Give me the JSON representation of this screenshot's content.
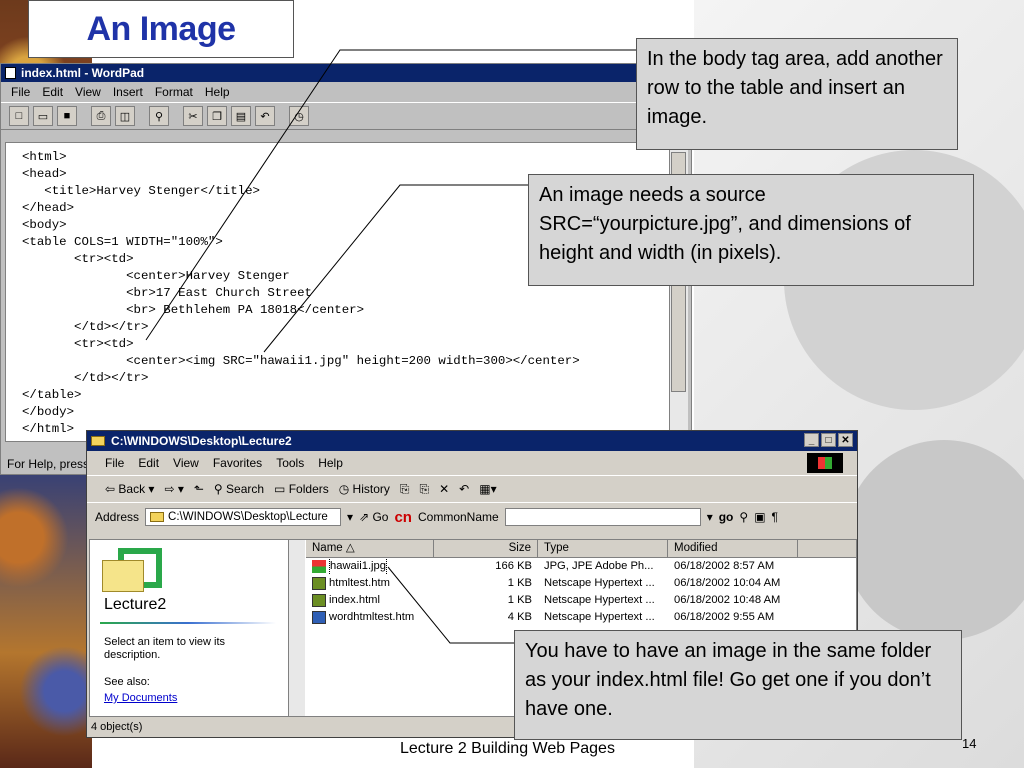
{
  "slide": {
    "title": "An Image",
    "footer": "Lecture 2 Building Web Pages",
    "page_number": "14"
  },
  "wordpad": {
    "window_title": "index.html - WordPad",
    "menu": [
      "File",
      "Edit",
      "View",
      "Insert",
      "Format",
      "Help"
    ],
    "code": "<html>\n<head>\n   <title>Harvey Stenger</title>\n</head>\n<body>\n<table COLS=1 WIDTH=\"100%\">\n       <tr><td>\n              <center>Harvey Stenger\n              <br>17 East Church Street\n              <br> Bethlehem PA 18018</center>\n       </td></tr>\n       <tr><td>\n              <center><img SRC=\"hawaii1.jpg\" height=200 width=300></center>\n       </td></tr>\n</table>\n</body>\n</html>",
    "status": "For Help, press"
  },
  "explorer": {
    "window_title": "C:\\WINDOWS\\Desktop\\Lecture2",
    "menu": [
      "File",
      "Edit",
      "View",
      "Favorites",
      "Tools",
      "Help"
    ],
    "toolbar": {
      "back": "Back",
      "search": "Search",
      "folders": "Folders",
      "history": "History"
    },
    "address_label": "Address",
    "address_value": "C:\\WINDOWS\\Desktop\\Lecture",
    "go": "Go",
    "cn_logo": "cn",
    "cn_label": "CommonName",
    "go_small": "go",
    "left_pane": {
      "folder_name": "Lecture2",
      "hint": "Select an item to view its description.",
      "see_also": "See also:",
      "link": "My Documents"
    },
    "columns": [
      "Name",
      "Size",
      "Type",
      "Modified"
    ],
    "files": [
      {
        "name": "hawaii1.jpg",
        "size": "166 KB",
        "type": "JPG, JPE Adobe Ph...",
        "modified": "06/18/2002 8:57 AM"
      },
      {
        "name": "htmltest.htm",
        "size": "1 KB",
        "type": "Netscape Hypertext ...",
        "modified": "06/18/2002 10:04 AM"
      },
      {
        "name": "index.html",
        "size": "1 KB",
        "type": "Netscape Hypertext ...",
        "modified": "06/18/2002 10:48 AM"
      },
      {
        "name": "wordhtmltest.htm",
        "size": "4 KB",
        "type": "Netscape Hypertext ...",
        "modified": "06/18/2002 9:55 AM"
      }
    ],
    "status": "4 object(s)"
  },
  "callouts": {
    "body_tag": "In the body tag area, add another row to the table and insert an image.",
    "source": "An image needs a source SRC=“yourpicture.jpg”, and dimensions of height and width (in pixels).",
    "folder": "You have to have an image in the same folder as your index.html file! Go get one if you don’t have one."
  }
}
